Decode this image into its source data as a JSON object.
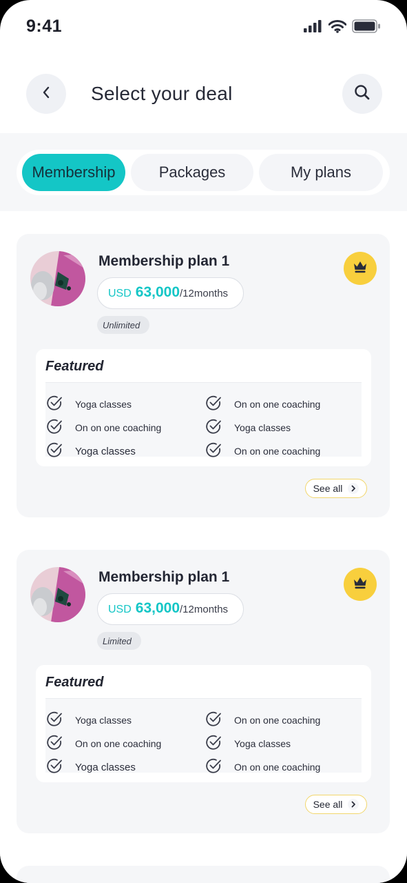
{
  "status_bar": {
    "time": "9:41"
  },
  "header": {
    "title": "Select your deal"
  },
  "tabs": [
    {
      "label": "Membership",
      "active": true
    },
    {
      "label": "Packages",
      "active": false
    },
    {
      "label": "My plans",
      "active": false
    }
  ],
  "colors": {
    "accent": "#14c6c6",
    "crown": "#f8cf3d",
    "see_all_border": "#f2d66b"
  },
  "cards": [
    {
      "name": "Membership plan 1",
      "currency": "USD",
      "amount": "63,000",
      "period": "/12months",
      "tag": "Unlimited",
      "featured_title": "Featured",
      "features": [
        "Yoga classes",
        "On on one coaching",
        "On on one coaching",
        "Yoga classes",
        "Yoga classes",
        "On on one coaching"
      ],
      "see_all": "See all"
    },
    {
      "name": "Membership plan 1",
      "currency": "USD",
      "amount": "63,000",
      "period": "/12months",
      "tag": "Limited",
      "featured_title": "Featured",
      "features": [
        "Yoga classes",
        "On on one coaching",
        "On on one coaching",
        "Yoga classes",
        "Yoga classes",
        "On on one coaching"
      ],
      "see_all": "See all"
    }
  ],
  "icons": {
    "back": "chevron-left-icon",
    "search": "search-icon",
    "crown": "crown-icon",
    "check": "check-circle-icon",
    "chevron": "chevron-right-icon"
  }
}
